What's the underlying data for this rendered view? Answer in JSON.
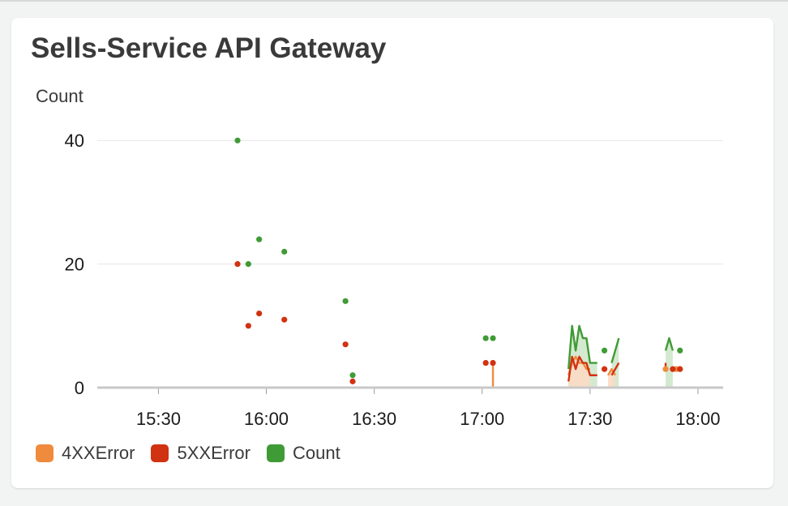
{
  "widget": {
    "title": "Sells-Service API Gateway"
  },
  "chart_data": {
    "type": "line",
    "title": "Sells-Service API Gateway",
    "ylabel": "Count",
    "xlabel": "",
    "ylim": [
      0,
      42
    ],
    "xlim": [
      "15:13",
      "18:07"
    ],
    "y_ticks": [
      0,
      20,
      40
    ],
    "x_ticks": [
      "15:30",
      "16:00",
      "16:30",
      "17:00",
      "17:30",
      "18:00"
    ],
    "grid": true,
    "legend_placement": "bottom-left",
    "series": [
      {
        "name": "4XXError",
        "color": "#f08a3c",
        "fill": "#fcdcc4",
        "style": "area",
        "points": [
          [
            "17:03",
            0
          ],
          [
            "17:03",
            4
          ],
          [
            "17:24",
            2
          ],
          [
            "17:25",
            4
          ],
          [
            "17:26",
            5
          ],
          [
            "17:27",
            4
          ],
          [
            "17:28",
            4
          ],
          [
            "17:29",
            3
          ],
          [
            "17:30",
            3
          ],
          [
            "17:35",
            2
          ],
          [
            "17:36",
            3
          ],
          [
            "17:37",
            2
          ],
          [
            "17:51",
            3
          ],
          [
            "17:54",
            3
          ]
        ]
      },
      {
        "name": "5XXError",
        "color": "#d13212",
        "points": [
          [
            "15:52",
            20
          ],
          [
            "15:55",
            10
          ],
          [
            "15:58",
            12
          ],
          [
            "16:05",
            11
          ],
          [
            "16:22",
            7
          ],
          [
            "16:24",
            1
          ],
          [
            "17:01",
            4
          ],
          [
            "17:03",
            4
          ],
          [
            "17:24",
            1
          ],
          [
            "17:25",
            5
          ],
          [
            "17:26",
            3
          ],
          [
            "17:27",
            5
          ],
          [
            "17:28",
            4
          ],
          [
            "17:29",
            4
          ],
          [
            "17:30",
            2
          ],
          [
            "17:31",
            2
          ],
          [
            "17:32",
            2
          ],
          [
            "17:34",
            3
          ],
          [
            "17:36",
            2
          ],
          [
            "17:37",
            3
          ],
          [
            "17:38",
            4
          ],
          [
            "17:51",
            3
          ],
          [
            "17:51",
            4
          ],
          [
            "17:53",
            3
          ],
          [
            "17:55",
            3
          ]
        ]
      },
      {
        "name": "Count",
        "color": "#3f9b35",
        "fill": "#cfe8cb",
        "points": [
          [
            "15:52",
            40
          ],
          [
            "15:55",
            20
          ],
          [
            "15:58",
            24
          ],
          [
            "16:05",
            22
          ],
          [
            "16:22",
            14
          ],
          [
            "16:24",
            2
          ],
          [
            "17:01",
            8
          ],
          [
            "17:03",
            8
          ],
          [
            "17:24",
            3
          ],
          [
            "17:25",
            10
          ],
          [
            "17:26",
            6
          ],
          [
            "17:27",
            10
          ],
          [
            "17:28",
            8
          ],
          [
            "17:29",
            8
          ],
          [
            "17:30",
            4
          ],
          [
            "17:31",
            4
          ],
          [
            "17:32",
            4
          ],
          [
            "17:34",
            6
          ],
          [
            "17:36",
            4
          ],
          [
            "17:37",
            6
          ],
          [
            "17:38",
            8
          ],
          [
            "17:51",
            6
          ],
          [
            "17:52",
            8
          ],
          [
            "17:53",
            6
          ],
          [
            "17:55",
            6
          ]
        ]
      }
    ]
  }
}
